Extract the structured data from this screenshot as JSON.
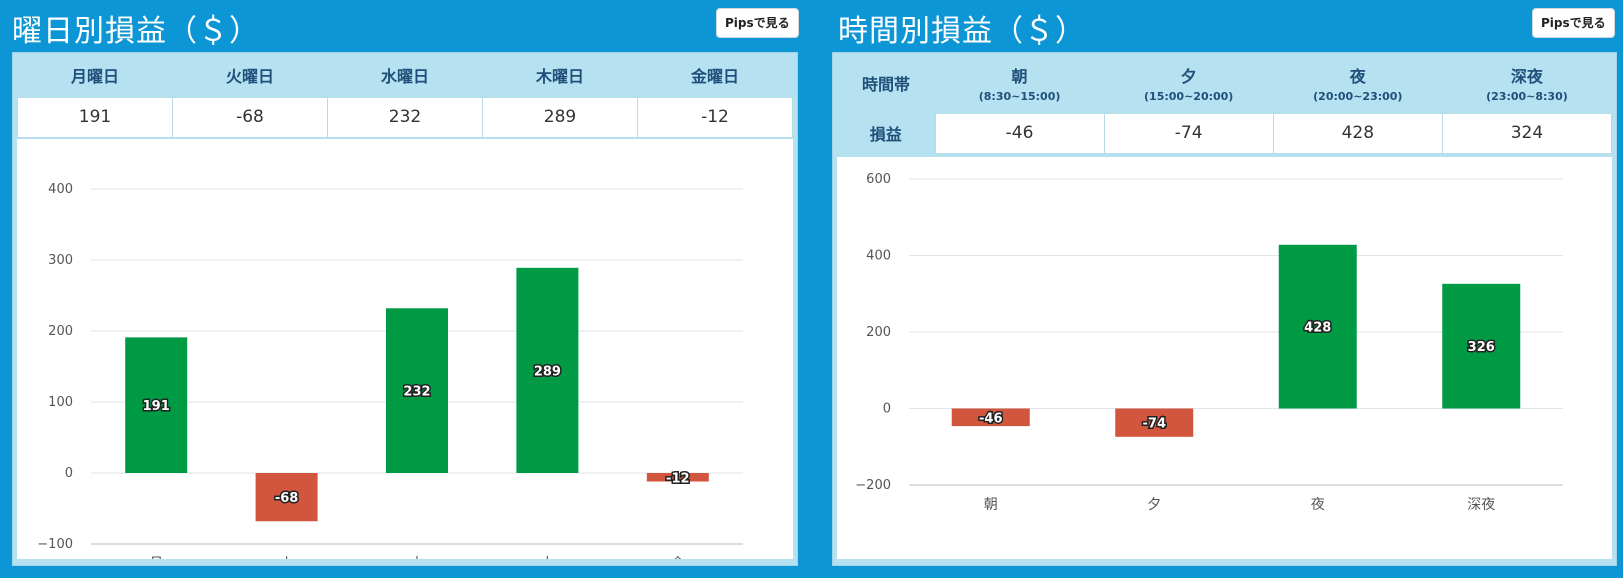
{
  "colors": {
    "background": "#0d96d6",
    "header": "#b6e1f0",
    "positive": "#009944",
    "negative": "#d2553d",
    "grid": "#dde6ea"
  },
  "left": {
    "title": "曜日別損益（＄）",
    "pips_button": "Pipsで見る",
    "table": {
      "headers": [
        "月曜日",
        "火曜日",
        "水曜日",
        "木曜日",
        "金曜日"
      ],
      "values": [
        "191",
        "-68",
        "232",
        "289",
        "-12"
      ]
    },
    "ticks": [
      "400",
      "300",
      "200",
      "100",
      "0",
      "−100"
    ]
  },
  "right": {
    "title": "時間別損益（＄）",
    "pips_button": "Pipsで見る",
    "table": {
      "corner_label": "時間帯",
      "row_label": "損益",
      "headers": [
        {
          "name": "朝",
          "range": "(8:30~15:00)"
        },
        {
          "name": "夕",
          "range": "(15:00~20:00)"
        },
        {
          "name": "夜",
          "range": "(20:00~23:00)"
        },
        {
          "name": "深夜",
          "range": "(23:00~8:30)"
        }
      ],
      "values": [
        "-46",
        "-74",
        "428",
        "324"
      ]
    },
    "ticks": [
      "600",
      "400",
      "200",
      "0",
      "−200"
    ]
  },
  "chart_data": [
    {
      "type": "bar",
      "categories": [
        "月",
        "火",
        "水",
        "木",
        "金"
      ],
      "values": [
        191,
        -68,
        232,
        289,
        -12
      ],
      "labels": [
        "191",
        "-68",
        "232",
        "289",
        "-12"
      ],
      "ylim": [
        -100,
        400
      ],
      "yticks": [
        400,
        300,
        200,
        100,
        0,
        -100
      ],
      "grid": true
    },
    {
      "type": "bar",
      "categories": [
        "朝",
        "夕",
        "夜",
        "深夜"
      ],
      "values": [
        -46,
        -74,
        428,
        326
      ],
      "labels": [
        "-46",
        "-74",
        "428",
        "326"
      ],
      "ylim": [
        -200,
        600
      ],
      "yticks": [
        600,
        400,
        200,
        0,
        -200
      ],
      "grid": true
    }
  ]
}
